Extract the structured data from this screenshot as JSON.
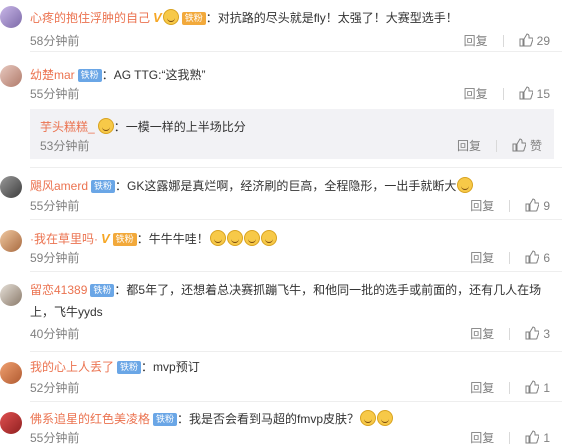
{
  "comments": [
    {
      "user": "心疼的抱住浮肿的自己",
      "badge": "铁粉",
      "text": "：对抗路的尽头就是fly！太强了！大赛型选手！",
      "time": "58分钟前",
      "reply": "回复",
      "likes": "29"
    },
    {
      "user": "幼楚mar",
      "badge": "铁粉",
      "text": "：AG TTG:“这我熟”",
      "time": "55分钟前",
      "reply": "回复",
      "likes": "15"
    },
    {
      "user": "芋头糕糕_",
      "text": "：一模一样的上半场比分",
      "time": "53分钟前",
      "reply": "回复",
      "likes": "赞"
    },
    {
      "user": "飓风amerd",
      "badge": "铁粉",
      "text": "：GK这露娜是真烂啊，经济刷的巨高，全程隐形，一出手就断大",
      "time": "55分钟前",
      "reply": "回复",
      "likes": "9"
    },
    {
      "user": "·我在草里吗·",
      "badge": "铁粉",
      "text": "：牛牛牛哇！",
      "time": "59分钟前",
      "reply": "回复",
      "likes": "6"
    },
    {
      "user": "留恋41389",
      "badge": "铁粉",
      "text": "：都5年了，还想着总决赛抓蹦飞牛，和他同一批的选手或前面的，还有几人在场",
      "text2": "上，飞牛yyds",
      "time": "40分钟前",
      "reply": "回复",
      "likes": "3"
    },
    {
      "user": "我的心上人丢了",
      "badge": "铁粉",
      "text": "：mvp预订",
      "time": "52分钟前",
      "reply": "回复",
      "likes": "1"
    },
    {
      "user": "佛系追星的红色美凌格",
      "badge": "铁粉",
      "text": "：我是否会看到马超的fmvp皮肤？",
      "time": "55分钟前",
      "reply": "回复",
      "likes": "1"
    }
  ],
  "icons": {
    "like": "thumbs-up-icon",
    "verified": "verified-v-icon",
    "emoji": "emoji-sticker-icon"
  },
  "colors": {
    "username": "#eb7350",
    "fan_badge": "#6aa6e6",
    "gold_badge": "#f2a93b",
    "meta": "#808080"
  }
}
